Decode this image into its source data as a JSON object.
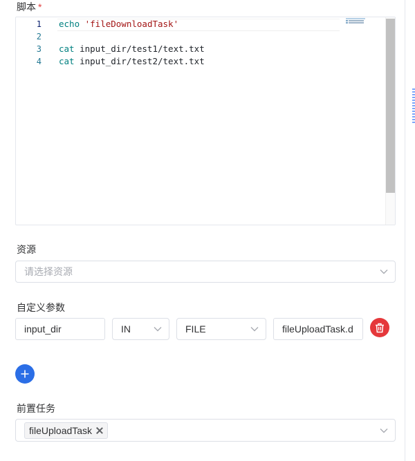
{
  "script": {
    "label": "脚本",
    "required_mark": "*",
    "lines": [
      {
        "no": "1",
        "kw": "echo",
        "rest": " 'fileDownloadTask'"
      },
      {
        "no": "2",
        "kw": "",
        "rest": ""
      },
      {
        "no": "3",
        "kw": "cat",
        "rest": " input_dir/test1/text.txt"
      },
      {
        "no": "4",
        "kw": "cat",
        "rest": " input_dir/test2/text.txt"
      }
    ]
  },
  "resources": {
    "label": "资源",
    "placeholder": "请选择资源"
  },
  "custom_params": {
    "label": "自定义参数",
    "rows": [
      {
        "prop": "input_dir",
        "direct": "IN",
        "type": "FILE",
        "value": "fileUploadTask.d"
      }
    ]
  },
  "pre_tasks": {
    "label": "前置任务",
    "tags": [
      "fileUploadTask"
    ]
  },
  "colors": {
    "primary": "#2b6ee6",
    "danger": "#e5383b",
    "required": "#e03e3e"
  },
  "icons": {
    "delete": "trash-icon",
    "add": "plus-icon",
    "select_arrow": "chevron-down-icon",
    "tag_close": "close-icon"
  }
}
